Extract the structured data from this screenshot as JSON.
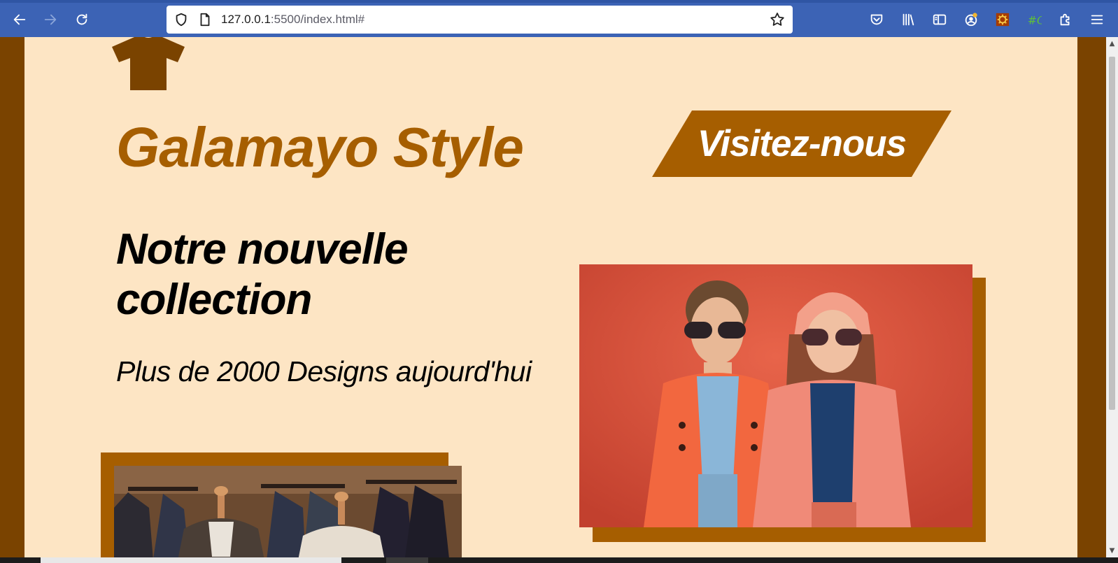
{
  "browser": {
    "url_host": "127.0.0.1",
    "url_rest": ":5500/index.html#",
    "buttons": [
      "back-icon",
      "forward-icon",
      "reload-icon",
      "pocket-icon",
      "library-icon",
      "sidebar-icon",
      "account-icon",
      "extension-icon",
      "hashtag-extension-icon",
      "extensions-icon",
      "menu-icon"
    ]
  },
  "page": {
    "brand": "Galamayo Style",
    "visit_button": "Visitez-nous",
    "headline": "Notre nouvelle collection",
    "subline": "Plus de 2000 Designs aujourd'hui"
  },
  "colors": {
    "accent": "#a65e00",
    "page_background": "#fde5c4",
    "frame": "#7a4300",
    "toolbar": "#3c63b5"
  }
}
